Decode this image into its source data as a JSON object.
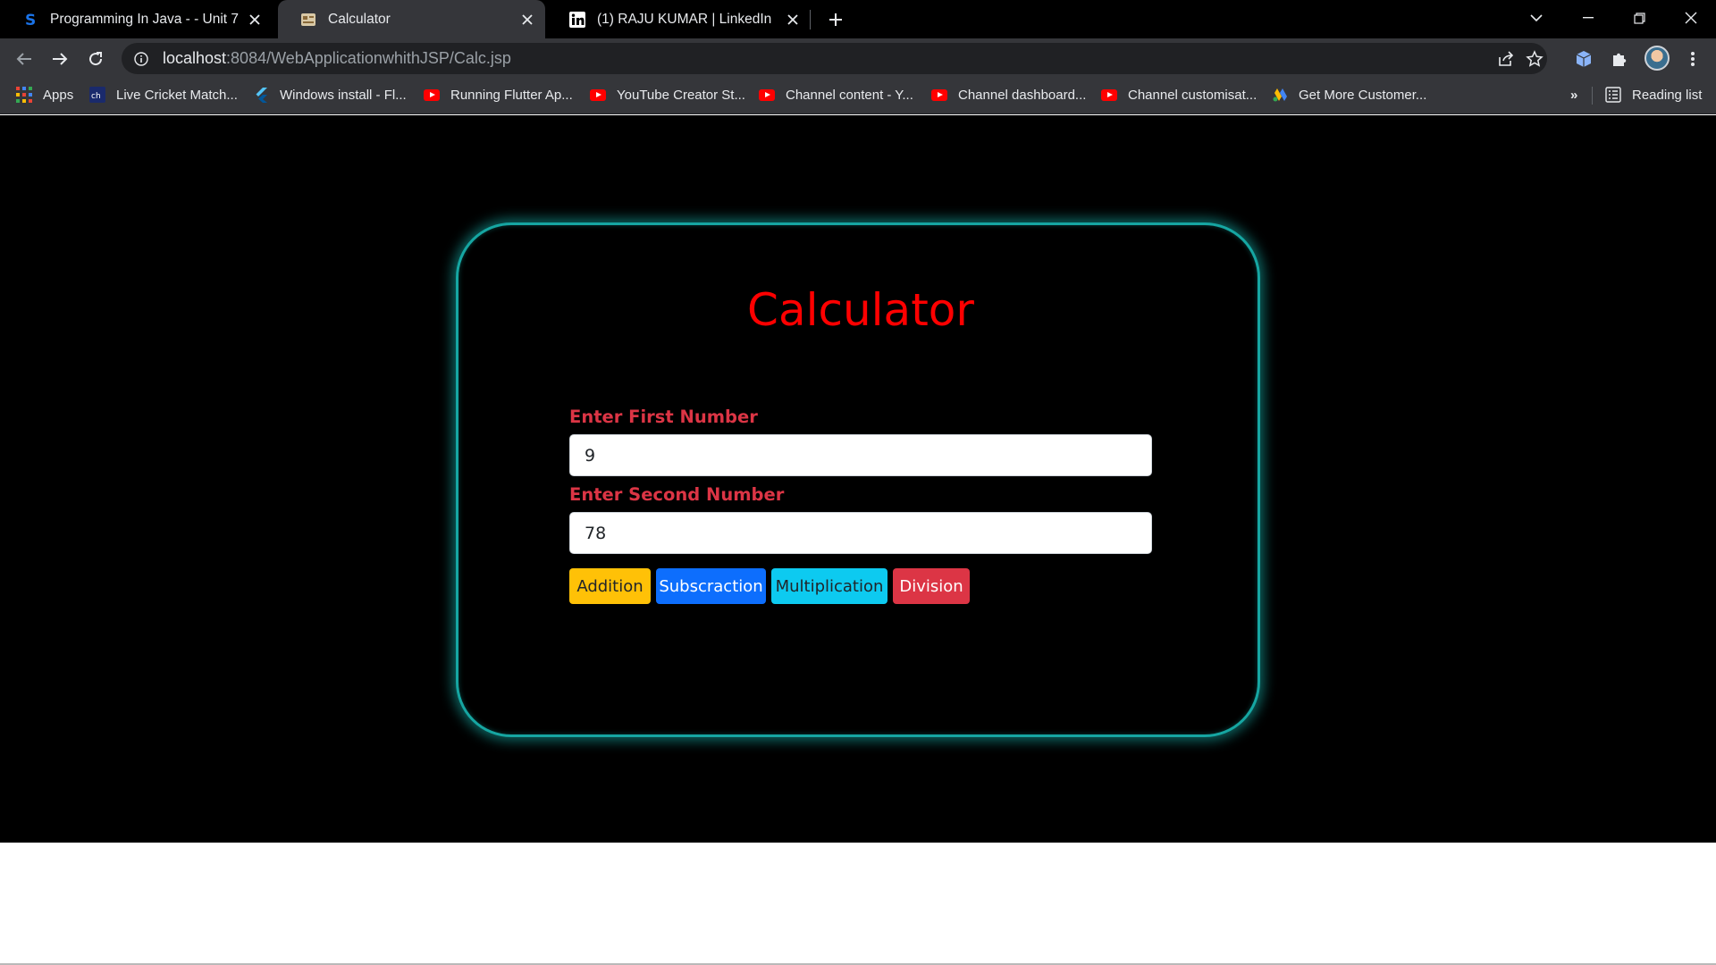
{
  "tabs": [
    {
      "title": "Programming In Java - - Unit 7 -",
      "favicon": "s-logo-icon",
      "active": false
    },
    {
      "title": "Calculator",
      "favicon": "page-icon",
      "active": true
    },
    {
      "title": "(1) RAJU KUMAR | LinkedIn",
      "favicon": "linkedin-icon",
      "active": false
    }
  ],
  "address_bar": {
    "host": "localhost",
    "path": ":8084/WebApplicationwhithJSP/Calc.jsp"
  },
  "bookmarks": [
    {
      "label": "Apps",
      "icon": "apps-grid-icon"
    },
    {
      "label": "Live Cricket Match...",
      "icon": "cricket-site-icon"
    },
    {
      "label": "Windows install - Fl...",
      "icon": "flutter-icon"
    },
    {
      "label": "Running Flutter Ap...",
      "icon": "youtube-icon"
    },
    {
      "label": "YouTube Creator St...",
      "icon": "youtube-icon"
    },
    {
      "label": "Channel content - Y...",
      "icon": "youtube-icon"
    },
    {
      "label": "Channel dashboard...",
      "icon": "youtube-icon"
    },
    {
      "label": "Channel customisat...",
      "icon": "youtube-icon"
    },
    {
      "label": "Get More Customer...",
      "icon": "google-ads-icon"
    }
  ],
  "reading_list": "Reading list",
  "more_bookmarks": "»",
  "page": {
    "title": "Calculator",
    "first_label": "Enter First Number",
    "first_value": "9",
    "second_label": "Enter Second Number",
    "second_value": "78",
    "buttons": {
      "add": "Addition",
      "sub": "Subscraction",
      "mul": "Multiplication",
      "div": "Division"
    }
  },
  "colors": {
    "title": "#ff0000",
    "label": "#dc3545",
    "card_glow": "#16a6a2",
    "btn_add": "#ffc107",
    "btn_sub": "#0d6efd",
    "btn_mul": "#0dcaf0",
    "btn_div": "#dc3545"
  }
}
